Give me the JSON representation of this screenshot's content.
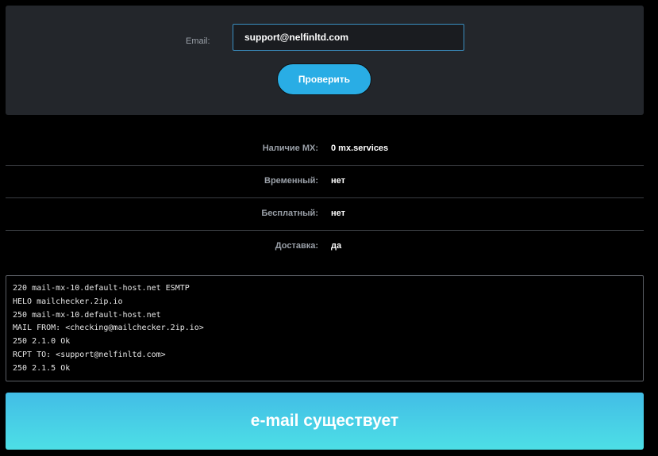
{
  "form": {
    "email_label": "Email:",
    "email_value": "support@nelfinltd.com",
    "check_button_label": "Проверить"
  },
  "results": [
    {
      "label": "Наличие MX:",
      "value": "0 mx.services"
    },
    {
      "label": "Временный:",
      "value": "нет"
    },
    {
      "label": "Бесплатный:",
      "value": "нет"
    },
    {
      "label": "Доставка:",
      "value": "да"
    }
  ],
  "smtp_log": [
    "220 mail-mx-10.default-host.net ESMTP",
    "HELO mailchecker.2ip.io",
    "250 mail-mx-10.default-host.net",
    "MAIL FROM: <checking@mailchecker.2ip.io>",
    "250 2.1.0 Ok",
    "RCPT TO: <support@nelfinltd.com>",
    "250 2.1.5 Ok"
  ],
  "status": {
    "text": "e-mail существует"
  },
  "colors": {
    "background": "#000000",
    "panel": "#23262b",
    "accent_button": "#29ade5",
    "banner_top": "#42bde6",
    "banner_bottom": "#4ddfe6"
  }
}
